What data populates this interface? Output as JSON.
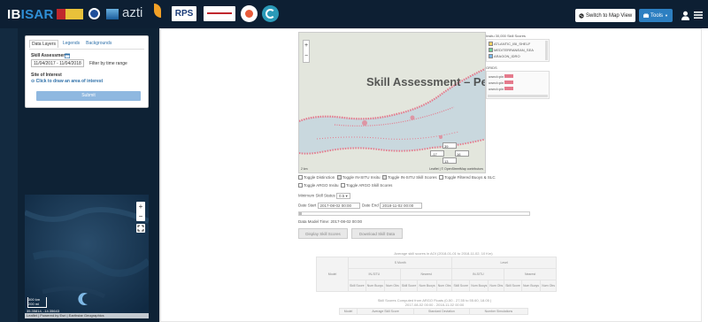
{
  "app": {
    "brand_prefix": "IB",
    "brand_suffix": "ISAR",
    "logo_azti": "azti",
    "logo_rps": "RPS"
  },
  "header": {
    "map_view_label": "Switch to Map View",
    "tools_label": "Tools"
  },
  "layers_panel": {
    "tabs": [
      "Data Layers",
      "Legends",
      "Backgrounds"
    ],
    "skill_label": "Skill Assessment:",
    "date_range": "11/04/2017 - 11/04/2018",
    "filter_label": "Filter by time range",
    "site_label": "Site of Interest",
    "site_link": "Click to draw an area of interest",
    "submit_label": "Submit"
  },
  "minimap": {
    "scale_top": "300 km",
    "scale_bottom": "200 mi",
    "coords": "35.35814, -14.35643",
    "attribution": "Leaflet | Powered by Esri | Earthstar Geographics"
  },
  "map": {
    "zoom_in": "+",
    "zoom_out": "−",
    "overlay_title": "Skill Assessment – Pending",
    "coord_lat": "39",
    "coord_lon1": "-17",
    "coord_lon2": "16",
    "coord_z": "13",
    "attribution": "Leaflet | © OpenStreetMap contributors",
    "scale_text": "2 km"
  },
  "legend": {
    "title_top": "Insitu 30,000 Skill Scores",
    "items_top": [
      "ATLANTIC_IBI_SHELF",
      "MEDITERRANEAN_SEA",
      "ARAGON_IDRO"
    ],
    "title_bottom": "GRIDS",
    "items_bottom": [
      "uwnd=pin",
      "uwnd=pin",
      "uwnd=pin"
    ]
  },
  "controls": {
    "toggles_row1": [
      "Toggle Distinction",
      "Toggle IN-SITU Insitu",
      "Toggle IN-SITU Skill Scores",
      "Toggle Filtered Buoys & SLC"
    ],
    "toggles_row2": [
      "Toggle ARGO Insitu",
      "Toggle ARGO Skill Scores"
    ],
    "min_skill_label": "Minimum Skill Status",
    "min_skill_value": "0.5",
    "date_start_label": "Date Start",
    "date_start": "2017-08-02 00:00",
    "date_end_label": "Date End",
    "date_end": "2018-11-02 00:00",
    "last_update": "Data Model Time: 2017-08-02 00:00",
    "display_btn": "Display Skill Scores",
    "download_btn": "Download Skill Data"
  },
  "table1": {
    "caption": "Average skill scores in AOI (2018-01-01 to 2018-11-02, 10 Km)",
    "group_a": "S Month",
    "group_b": "Level",
    "sub_a1": "IN-SITU",
    "sub_a2": "Nearest",
    "sub_b1": "IN-SITU",
    "sub_b2": "Nearest",
    "row_header": "Model",
    "cells": [
      "Skill Score",
      "Num Buoys",
      "Num Obs",
      "Skill Score",
      "Num Buoys",
      "Num Obs",
      "Skill Score",
      "Num Buoys",
      "Num Obs",
      "Skill Score",
      "Num Buoys",
      "Num Obs"
    ]
  },
  "table2": {
    "caption": "Skill Scores Computed from ARGO Floats (0-50 - 27,55 to 55.60, 18.05 )",
    "subcaption": "2017-08-02 00:00 - 2018-11-02 00:00",
    "headers": [
      "Model",
      "Average Skill Score",
      "Standard Deviation",
      "Number Simulations"
    ]
  }
}
